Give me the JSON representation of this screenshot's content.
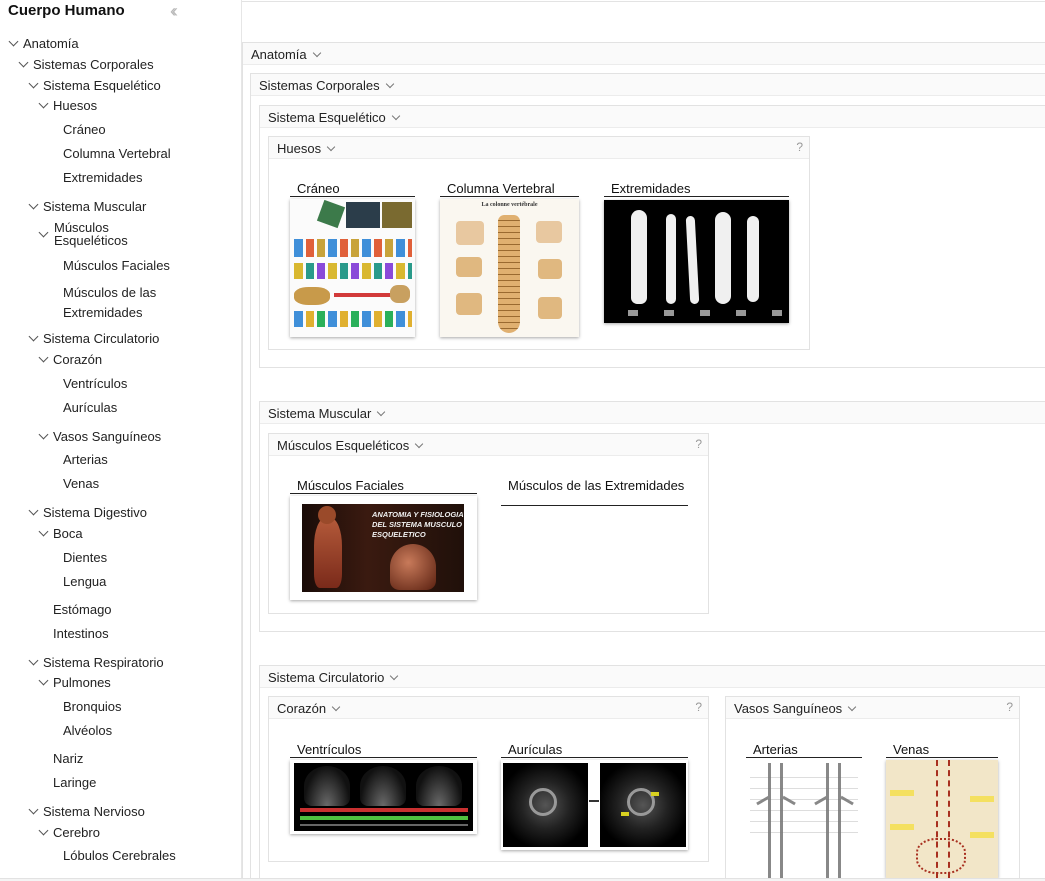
{
  "sidebar": {
    "title": "Cuerpo Humano",
    "collapse_icon": "double-chevron-left-icon",
    "tree": {
      "anatomia": "Anatomía",
      "sistemas": "Sistemas Corporales",
      "esqueletico": "Sistema Esquelético",
      "huesos": "Huesos",
      "craneo": "Cráneo",
      "columna": "Columna Vertebral",
      "extremidades": "Extremidades",
      "muscular": "Sistema Muscular",
      "musc_esq": "Músculos Esqueléticos",
      "musc_faciales": "Músculos Faciales",
      "musc_extremidades": "Músculos de las Extremidades",
      "circulatorio": "Sistema Circulatorio",
      "corazon": "Corazón",
      "ventriculos": "Ventrículos",
      "auriculas": "Aurículas",
      "vasos": "Vasos Sanguíneos",
      "arterias": "Arterias",
      "venas": "Venas",
      "digestivo": "Sistema Digestivo",
      "boca": "Boca",
      "dientes": "Dientes",
      "lengua": "Lengua",
      "estomago": "Estómago",
      "intestinos": "Intestinos",
      "respiratorio": "Sistema Respiratorio",
      "pulmones": "Pulmones",
      "bronquios": "Bronquios",
      "alveolos": "Alvéolos",
      "nariz": "Nariz",
      "laringe": "Laringe",
      "nervioso": "Sistema Nervioso",
      "cerebro": "Cerebro",
      "lobulos": "Lóbulos Cerebrales"
    }
  },
  "main": {
    "anatomia": "Anatomía",
    "sistemas": "Sistemas Corporales",
    "esqueletico": "Sistema Esquelético",
    "huesos": "Huesos",
    "muscular": "Sistema Muscular",
    "musc_esq": "Músculos Esqueléticos",
    "circulatorio": "Sistema Circulatorio",
    "corazon": "Corazón",
    "vasos": "Vasos Sanguíneos",
    "help": "?",
    "cards": {
      "craneo": "Cráneo",
      "columna": "Columna Vertebral",
      "extremidades": "Extremidades",
      "musc_faciales": "Músculos Faciales",
      "musc_extremidades": "Músculos de las Extremidades",
      "ventriculos": "Ventrículos",
      "auriculas": "Aurículas",
      "arterias": "Arterias",
      "venas": "Venas"
    },
    "image_text": {
      "spine_title": "La colonne vertébrale",
      "muscle_poster": "ANATOMIA Y FISIOLOGIA DEL SISTEMA MUSCULO ESQUELETICO"
    }
  },
  "colors": {
    "accent_link": "#e06b1f",
    "panel_header_bg": "#fafafa",
    "border": "#e2e2e2"
  }
}
